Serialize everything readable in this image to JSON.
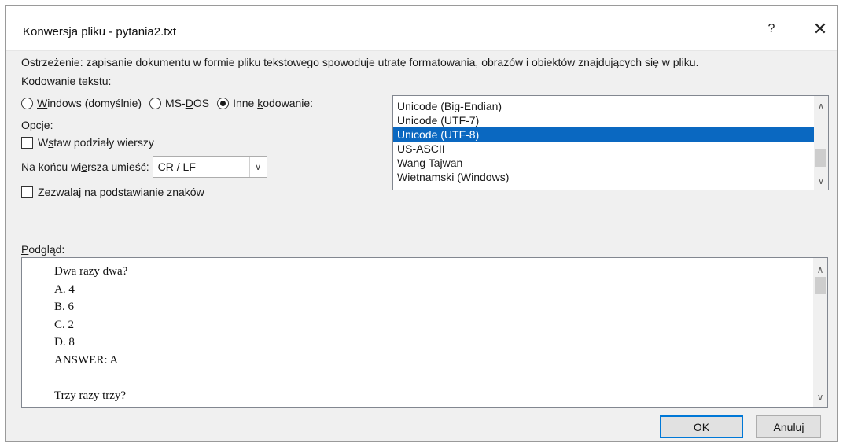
{
  "window": {
    "title": "Konwersja pliku - pytania2.txt",
    "help_glyph": "?",
    "close_glyph": "✕"
  },
  "warning": "Ostrzeżenie: zapisanie dokumentu w formie pliku tekstowego spowoduje utratę formatowania, obrazów i obiektów znajdujących się w pliku.",
  "encoding": {
    "label": "Kodowanie tekstu:",
    "options": {
      "windows": {
        "prefix": "",
        "mnemonic": "W",
        "suffix": "indows (domyślnie)",
        "selected": false
      },
      "msdos": {
        "prefix": "MS-",
        "mnemonic": "D",
        "suffix": "OS",
        "selected": false
      },
      "other": {
        "prefix": "Inne ",
        "mnemonic": "k",
        "suffix": "odowanie:",
        "selected": true
      }
    },
    "list": {
      "items": [
        "Unicode (Big-Endian)",
        "Unicode (UTF-7)",
        "Unicode (UTF-8)",
        "US-ASCII",
        "Wang Tajwan",
        "Wietnamski (Windows)"
      ],
      "selected_index": 2
    }
  },
  "options": {
    "label": "Opcje:",
    "insert_line_breaks": {
      "prefix": "W",
      "mnemonic": "s",
      "suffix": "taw podziały wierszy",
      "checked": false
    },
    "line_end": {
      "label_prefix": "Na końcu wi",
      "label_mnemonic": "e",
      "label_suffix": "rsza umieść:",
      "value": "CR / LF"
    },
    "allow_substitution": {
      "prefix": "",
      "mnemonic": "Z",
      "suffix": "ezwalaj na podstawianie znaków",
      "checked": false
    }
  },
  "preview": {
    "label_mnemonic": "P",
    "label_suffix": "odgląd:",
    "lines": [
      "Dwa razy dwa?",
      "A. 4",
      "B. 6",
      "C. 2",
      "D. 8",
      "ANSWER: A",
      "",
      "Trzy razy trzy?"
    ]
  },
  "buttons": {
    "ok": "OK",
    "cancel": "Anuluj"
  }
}
